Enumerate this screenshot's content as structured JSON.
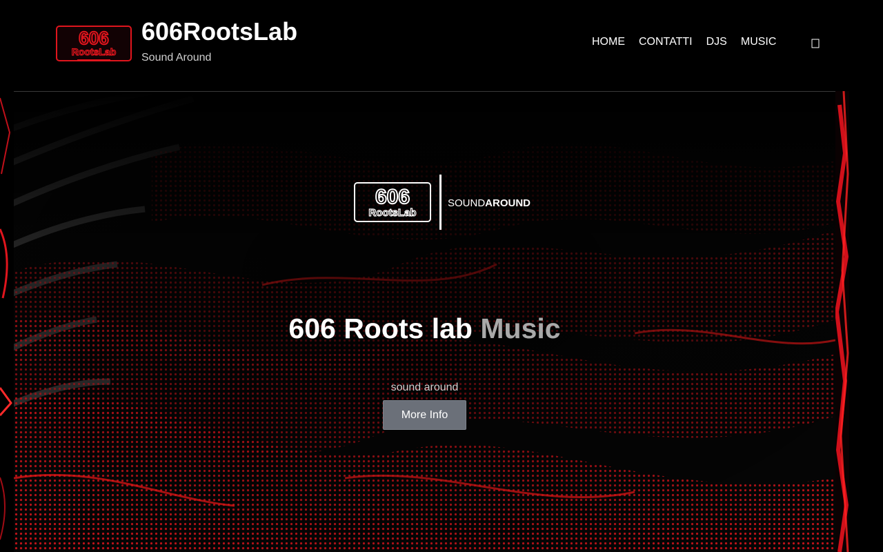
{
  "header": {
    "logo_icon": "606-rootslab-logo",
    "site_title": "606RootsLab",
    "tagline": "Sound Around",
    "nav": [
      {
        "label": "HOME"
      },
      {
        "label": "CONTATTI"
      },
      {
        "label": "DJS"
      },
      {
        "label": "MUSIC"
      }
    ],
    "search_icon": "search-icon"
  },
  "hero": {
    "brand_logo": {
      "mark_text_1": "606",
      "mark_text_2": "RootsLab",
      "sound_text": "SOUND",
      "around_text": "AROUND"
    },
    "heading_main": "606 Roots lab",
    "heading_accent": "Music",
    "subtitle": "sound around",
    "button_label": "More Info"
  },
  "colors": {
    "background": "#000000",
    "brand_red": "#e0151d",
    "button": "#6b7079",
    "accent_text": "#a9a9a9"
  }
}
